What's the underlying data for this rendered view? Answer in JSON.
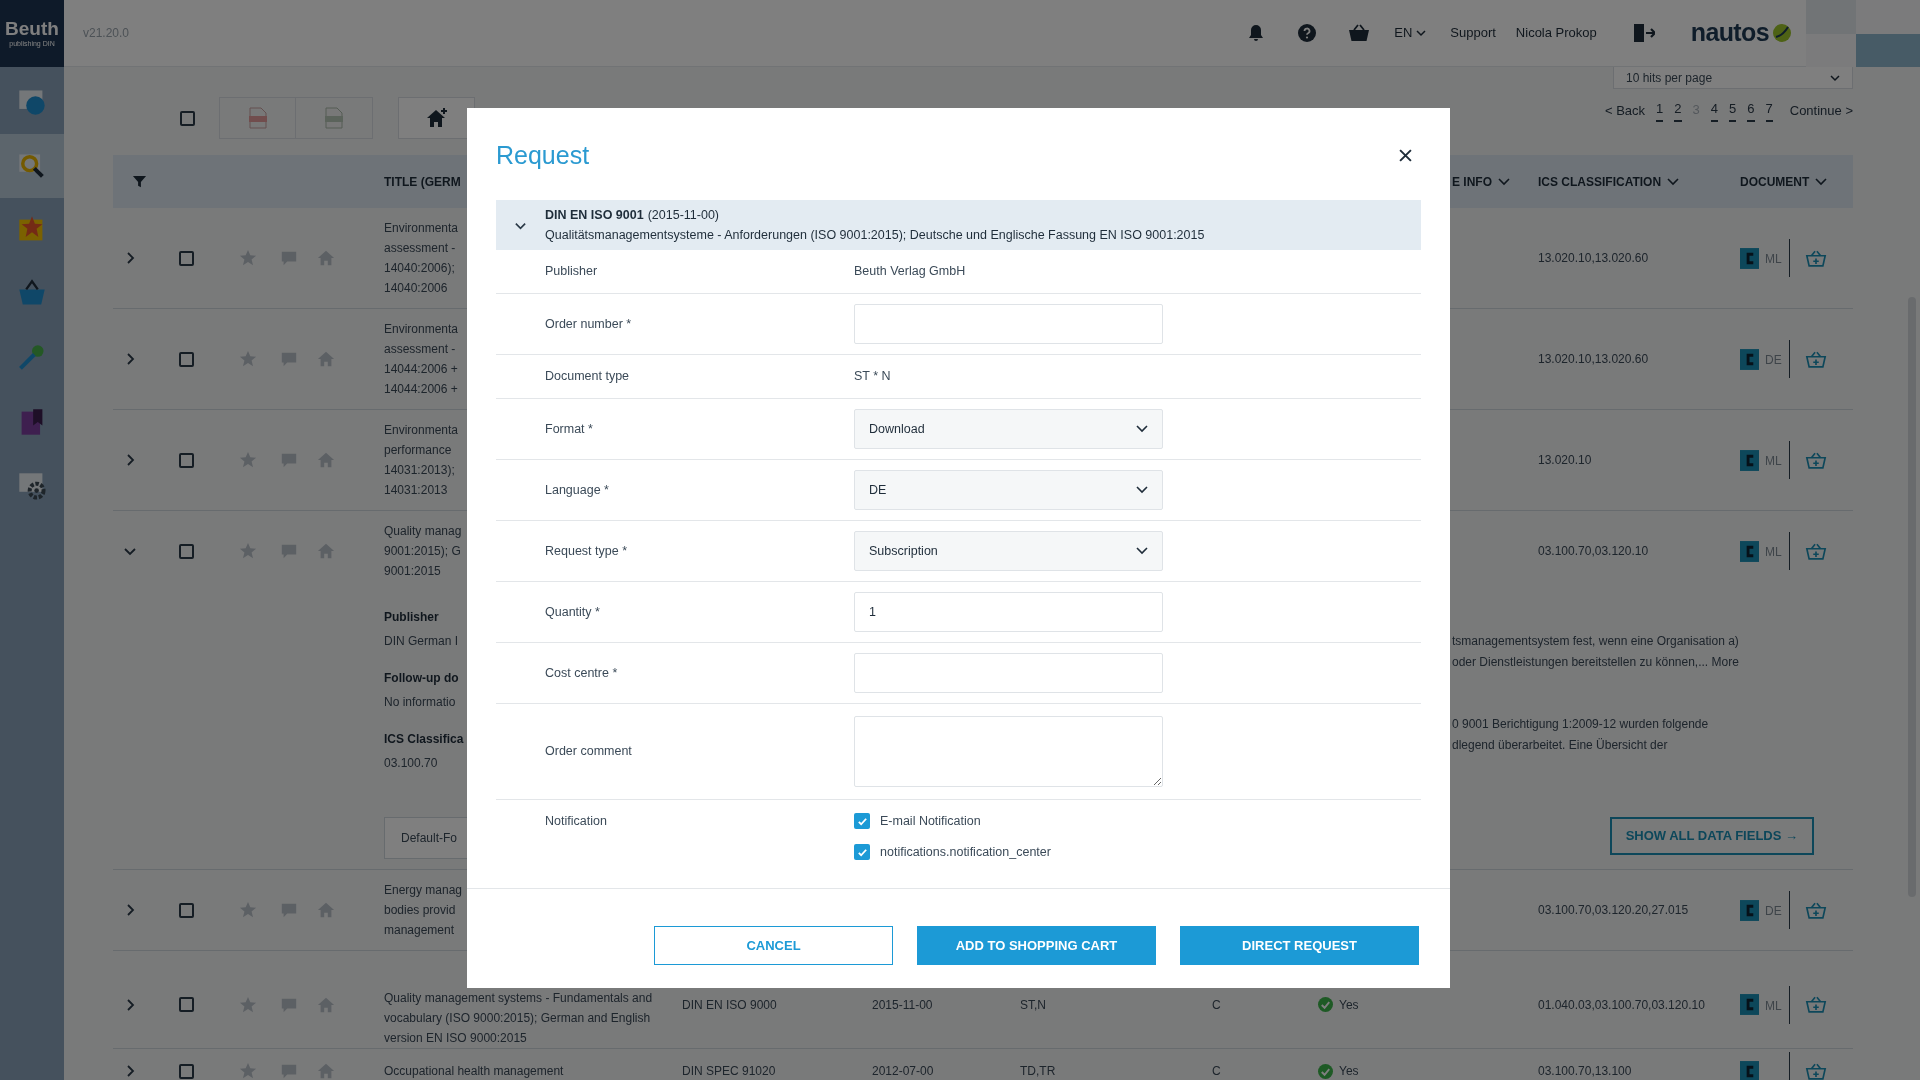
{
  "top_bar": {
    "logo": "Beuth",
    "logo_sub": "publishing DIN",
    "version": "v21.20.0",
    "language": "EN",
    "links": [
      "Support",
      "Nicola Prokop"
    ],
    "brand": "nautos"
  },
  "sidebar": {
    "items": [
      {
        "selected": false
      },
      {
        "selected": true
      },
      {
        "selected": false
      },
      {
        "selected": false
      },
      {
        "selected": false
      },
      {
        "selected": false
      },
      {
        "selected": false
      }
    ]
  },
  "select_all": {
    "checked": false
  },
  "per_page": "10 hits per page",
  "pagination": {
    "back": "< Back",
    "pages": [
      {
        "label": "1",
        "selected": false
      },
      {
        "label": "2",
        "selected": false
      },
      {
        "label": "3",
        "selected": true
      },
      {
        "label": "4",
        "selected": false
      },
      {
        "label": "5",
        "selected": false
      },
      {
        "label": "6",
        "selected": false
      },
      {
        "label": "7",
        "selected": false
      }
    ],
    "next": "Continue >"
  },
  "table": {
    "columns": [
      {
        "label": "TITLE (GERM",
        "kind": "title"
      },
      {
        "label": "E INFO",
        "kind": "info"
      },
      {
        "label": "ICS CLASSIFICATION",
        "kind": "ics"
      },
      {
        "label": "DOCUMENT",
        "kind": "document"
      }
    ],
    "rows": [
      {
        "expanded": false,
        "checked": false,
        "title_lines": [
          "Environmenta",
          "assessment -",
          "14040:2006);",
          "14040:2006"
        ],
        "ics": "13.020.10,13.020.60",
        "doc_lang": "ML"
      },
      {
        "expanded": false,
        "checked": false,
        "title_lines": [
          "Environmenta",
          "assessment -",
          "14044:2006 +",
          "14044:2006 +"
        ],
        "ics": "13.020.10,13.020.60",
        "doc_lang": "DE"
      },
      {
        "expanded": false,
        "checked": false,
        "title_lines": [
          "Environmenta",
          "performance",
          "14031:2013);",
          "14031:2013"
        ],
        "ics": "13.020.10",
        "doc_lang": "ML"
      },
      {
        "expanded": true,
        "checked": false,
        "title_lines": [
          "Quality manag",
          "9001:2015); G",
          "9001:2015"
        ],
        "ics": "03.100.70,03.120.10",
        "doc_lang": "ML",
        "details": {
          "left": [
            {
              "kind": "heading",
              "text": "Publisher"
            },
            {
              "kind": "text",
              "text": "DIN German I"
            },
            {
              "kind": "heading",
              "text": "Follow-up do"
            },
            {
              "kind": "text",
              "text": "No informatio"
            },
            {
              "kind": "heading",
              "text": "ICS Classifica"
            },
            {
              "kind": "text",
              "text": "03.100.70"
            }
          ],
          "paragraphs": [
            {
              "lines": [
                "tsmanagementsystem fest, wenn eine Organisation a)",
                "oder Dienstleistungen bereitstellen zu können,..."
              ],
              "link": "More"
            },
            {
              "lines": [
                "0 9001 Berichtigung 1:2009-12 wurden folgende",
                "dlegend überarbeitet. Eine Übersicht der"
              ]
            }
          ],
          "left_button": "Default-Fo",
          "right_button": "SHOW ALL DATA FIELDS →"
        }
      },
      {
        "expanded": false,
        "checked": false,
        "title_lines": [
          "Energy manag",
          "bodies provid",
          "management"
        ],
        "ics": "03.100.70,03.120.20,27.015",
        "doc_lang": "DE"
      },
      {
        "expanded": false,
        "checked": false,
        "title_lines": [
          "Quality management systems - Fundamentals and",
          "vocabulary (ISO 9000:2015); German and English",
          "version EN ISO 9000:2015"
        ],
        "number": "DIN EN ISO 9000",
        "date": "2015-11-00",
        "type": "ST,N",
        "c": "C",
        "available": "Yes",
        "ics": "01.040.03,03.100.70,03.120.10",
        "doc_lang": "ML"
      },
      {
        "expanded": false,
        "checked": false,
        "title_lines": [
          "Occupational health management"
        ],
        "number": "DIN SPEC 91020",
        "date": "2012-07-00",
        "type": "TD,TR",
        "c": "C",
        "available": "Yes",
        "ics": "03.100.70,13.100"
      }
    ]
  },
  "modal": {
    "title": "Request",
    "document": {
      "expanded": true,
      "number": "DIN EN ISO 9001",
      "date": "(2015-11-00)",
      "title": "Qualitätsmanagementsysteme - Anforderungen (ISO 9001:2015); Deutsche und Englische Fassung EN ISO 9001:2015"
    },
    "fields": [
      {
        "kind": "text",
        "label": "Publisher",
        "value": "Beuth Verlag GmbH"
      },
      {
        "kind": "input",
        "label": "Order number *"
      },
      {
        "kind": "text",
        "label": "Document type",
        "value": "ST * N"
      },
      {
        "kind": "select",
        "label": "Format *",
        "value": "Download"
      },
      {
        "kind": "select",
        "label": "Language *",
        "value": "DE"
      },
      {
        "kind": "select",
        "label": "Request type *",
        "value": "Subscription"
      },
      {
        "kind": "input",
        "label": "Quantity *",
        "value": "1"
      },
      {
        "kind": "input",
        "label": "Cost centre *"
      },
      {
        "kind": "textarea",
        "label": "Order comment"
      },
      {
        "kind": "checkboxes",
        "label": "Notification",
        "options": [
          {
            "label": "E-mail Notification",
            "checked": true
          },
          {
            "label": "notifications.notification_center",
            "checked": true
          }
        ]
      }
    ],
    "buttons": [
      {
        "label": "CANCEL",
        "kind": "secondary"
      },
      {
        "label": "ADD TO SHOPPING CART",
        "kind": "primary"
      },
      {
        "label": "DIRECT REQUEST",
        "kind": "primary"
      }
    ]
  }
}
